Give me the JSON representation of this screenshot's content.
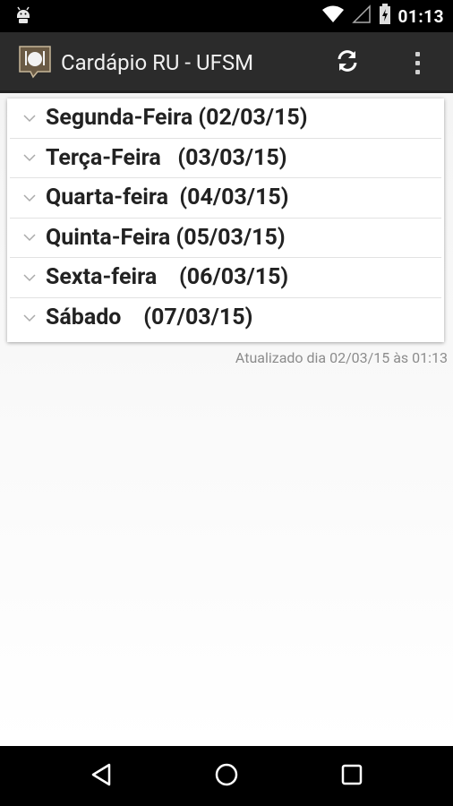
{
  "status_bar": {
    "time": "01:13",
    "icons": [
      "android-debug-icon",
      "wifi-icon",
      "cell-signal-icon",
      "battery-charging-icon"
    ]
  },
  "action_bar": {
    "title": "Cardápio RU - UFSM",
    "app_icon": "restaurant-icon",
    "actions": [
      "refresh-icon",
      "overflow-menu-icon"
    ]
  },
  "days": [
    {
      "label": "Segunda-Feira (02/03/15)"
    },
    {
      "label": "Terça-Feira   (03/03/15)"
    },
    {
      "label": "Quarta-feira  (04/03/15)"
    },
    {
      "label": "Quinta-Feira (05/03/15)"
    },
    {
      "label": "Sexta-feira    (06/03/15)"
    },
    {
      "label": "Sábado    (07/03/15)"
    }
  ],
  "updated_text": "Atualizado dia 02/03/15 às 01:13",
  "nav_bar": {
    "buttons": [
      "back-icon",
      "home-icon",
      "recents-icon"
    ]
  },
  "colors": {
    "action_bar_bg": "#2b2b2b",
    "app_icon_bg": "#5a4a35",
    "text_primary": "#222222",
    "text_secondary": "#8c8c8c"
  }
}
